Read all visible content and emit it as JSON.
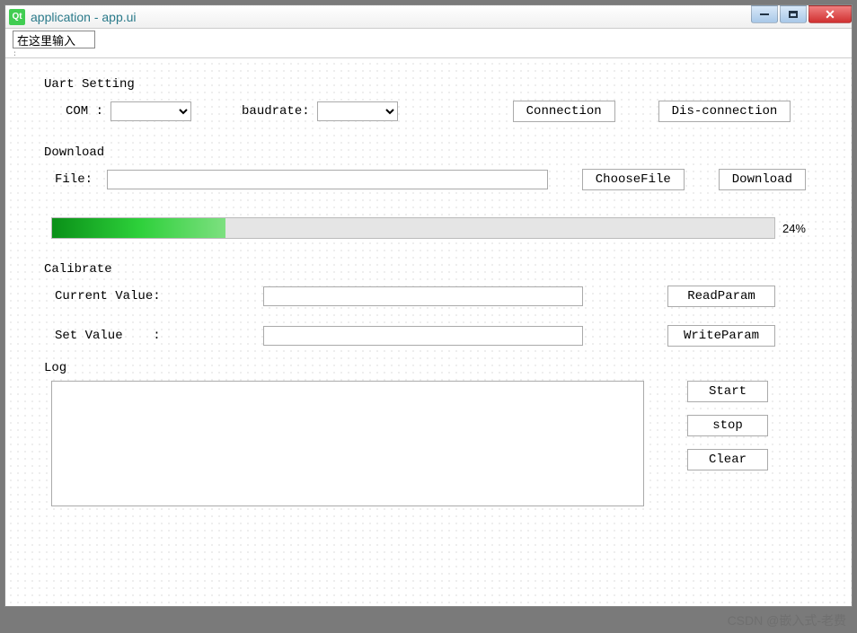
{
  "window": {
    "title": "application - app.ui",
    "logo_text": "Qt"
  },
  "toolbar": {
    "input_value": "在这里输入",
    "handle": ":"
  },
  "uart": {
    "group_title": "Uart Setting",
    "com_label": "COM :",
    "com_value": "",
    "baudrate_label": "baudrate:",
    "baudrate_value": "",
    "connection_btn": "Connection",
    "disconnection_btn": "Dis-connection"
  },
  "download": {
    "group_title": "Download",
    "file_label": "File:",
    "file_value": "",
    "choosefile_btn": "ChooseFile",
    "download_btn": "Download",
    "progress_percent": 24,
    "progress_text": "24%"
  },
  "calibrate": {
    "group_title": "Calibrate",
    "current_label": "Current Value:",
    "current_value": "",
    "set_label": "Set Value    :",
    "set_value": "",
    "read_btn": "ReadParam",
    "write_btn": "WriteParam"
  },
  "log": {
    "group_title": "Log",
    "content": "",
    "start_btn": "Start",
    "stop_btn": "stop",
    "clear_btn": "Clear"
  },
  "watermark": "CSDN @嵌入式-老费"
}
